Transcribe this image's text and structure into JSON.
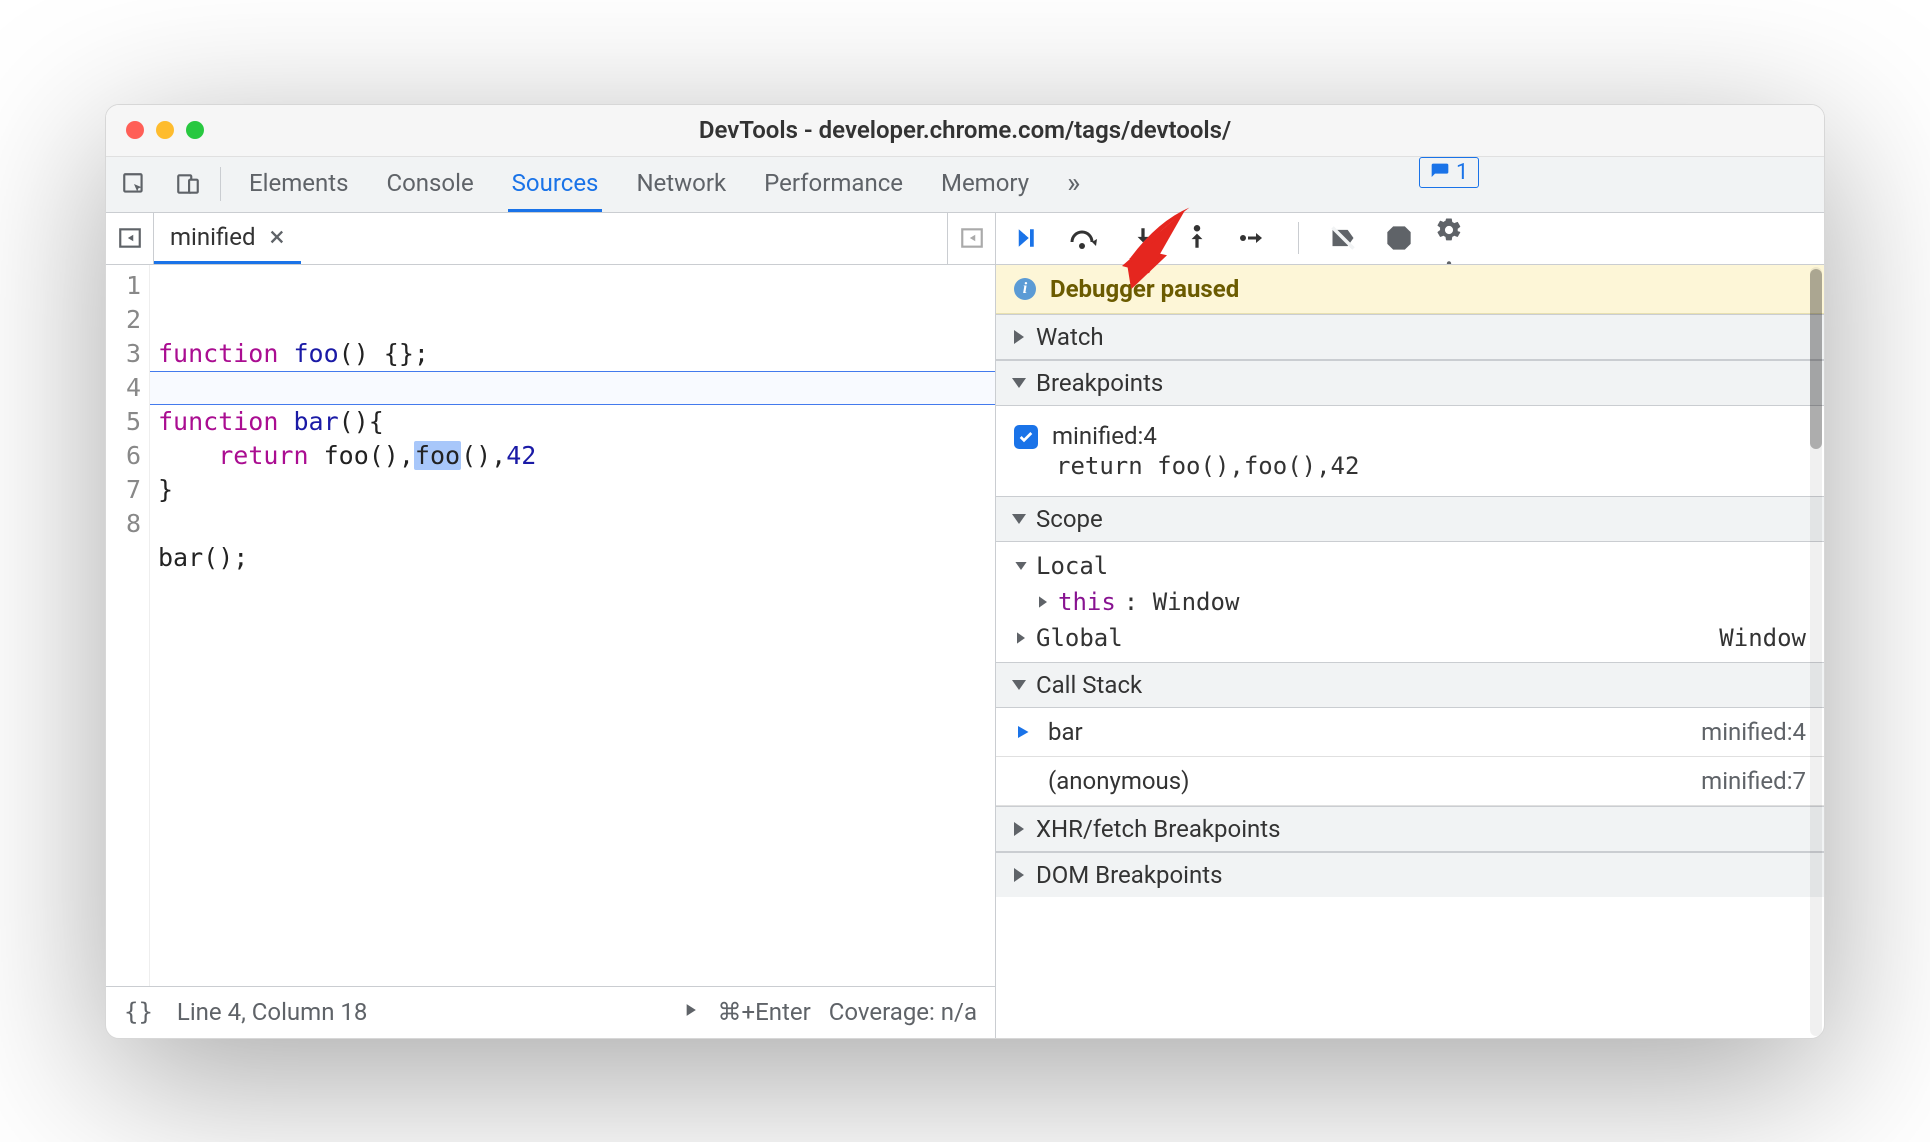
{
  "window": {
    "title": "DevTools - developer.chrome.com/tags/devtools/"
  },
  "toolbar": {
    "tabs": [
      "Elements",
      "Console",
      "Sources",
      "Network",
      "Performance",
      "Memory"
    ],
    "active": "Sources",
    "issues_count": "1"
  },
  "file_tab": {
    "name": "minified"
  },
  "editor": {
    "lines": [
      "1",
      "2",
      "3",
      "4",
      "5",
      "6",
      "7",
      "8"
    ],
    "code": {
      "l1": {
        "kw": "function",
        "fn": "foo",
        "rest": "() {};"
      },
      "l3": {
        "kw": "function",
        "fn": "bar",
        "rest": "(){"
      },
      "l4": {
        "ind": "    ",
        "ret": "return",
        "sp": " ",
        "a": "foo(),",
        "hl": "foo",
        "b": "(),",
        "num": "42"
      },
      "l5": "}",
      "l7": "bar();"
    }
  },
  "status": {
    "left_icon_label": "{}",
    "position": "Line 4, Column 18",
    "shortcut": "⌘+Enter",
    "coverage": "Coverage: n/a"
  },
  "debugger": {
    "banner": "Debugger paused",
    "sections": {
      "watch": "Watch",
      "breakpoints": "Breakpoints",
      "scope": "Scope",
      "callstack": "Call Stack",
      "xhr": "XHR/fetch Breakpoints",
      "dom": "DOM Breakpoints"
    },
    "breakpoint": {
      "label": "minified:4",
      "code": "return foo(),foo(),42"
    },
    "scope": {
      "local": "Local",
      "this_key": "this",
      "this_val": ": Window",
      "global": "Global",
      "global_val": "Window"
    },
    "callstack": [
      {
        "name": "bar",
        "loc": "minified:4",
        "current": true
      },
      {
        "name": "(anonymous)",
        "loc": "minified:7",
        "current": false
      }
    ]
  }
}
